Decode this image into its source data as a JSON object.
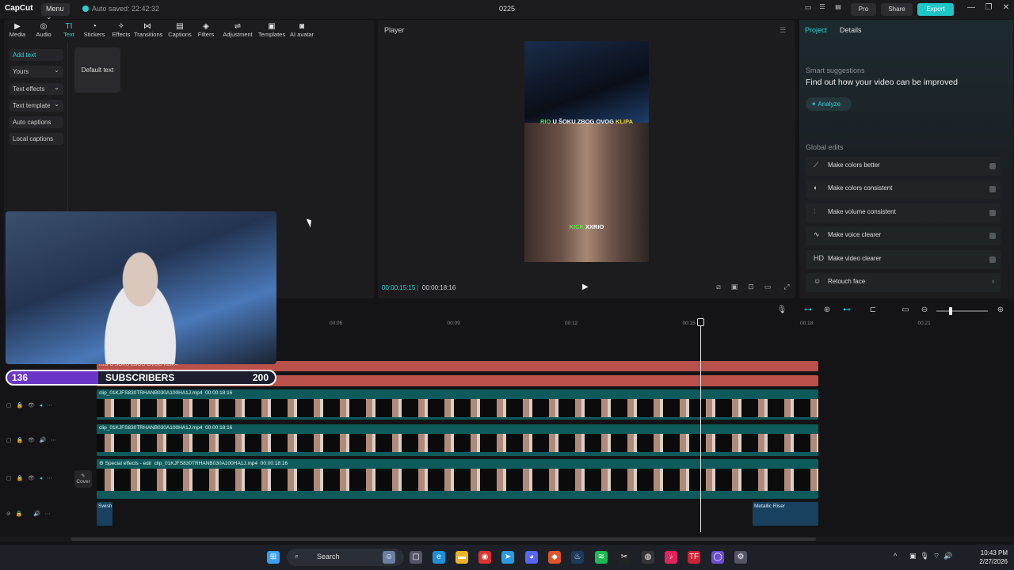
{
  "titlebar": {
    "app_name": "CapCut",
    "menu_label": "Menu",
    "autosave": "Auto saved: 22:42:32",
    "project_name": "0225",
    "pro_label": "Pro",
    "share_label": "Share",
    "export_label": "Export"
  },
  "toolbar": {
    "items": [
      {
        "label": "Media",
        "icon": "media-icon"
      },
      {
        "label": "Audio",
        "icon": "audio-icon"
      },
      {
        "label": "Text",
        "icon": "text-icon"
      },
      {
        "label": "Stickers",
        "icon": "stickers-icon"
      },
      {
        "label": "Effects",
        "icon": "effects-icon"
      },
      {
        "label": "Transitions",
        "icon": "transitions-icon"
      },
      {
        "label": "Captions",
        "icon": "captions-icon"
      },
      {
        "label": "Filters",
        "icon": "filters-icon"
      },
      {
        "label": "Adjustment",
        "icon": "adjustment-icon"
      },
      {
        "label": "Templates",
        "icon": "templates-icon"
      },
      {
        "label": "AI avatar",
        "icon": "ai-avatar-icon"
      }
    ],
    "active": "Text"
  },
  "text_sidebar": {
    "items": [
      "Add text",
      "Yours",
      "Text effects",
      "Text template",
      "Auto captions",
      "Local captions"
    ],
    "default_card": "Default text"
  },
  "player": {
    "title": "Player",
    "caption_top": {
      "a": "RIO",
      "b": "U ŠOKU ZBOG OVOG",
      "c": "KLIPA"
    },
    "caption_bottom": {
      "a": "KICK",
      "b": "XXRIO"
    },
    "time_current": "00:00:15:15",
    "time_total": "00:00:18:16"
  },
  "right_panel": {
    "tab_project": "Project",
    "tab_details": "Details",
    "smart_label": "Smart suggestions",
    "smart_title": "Find out how your video can be improved",
    "analyze_label": "Analyze",
    "global_label": "Global edits",
    "global_edits": [
      {
        "label": "Make colors better",
        "icon": "magic-wand-icon"
      },
      {
        "label": "Make colors consistent",
        "icon": "palette-icon"
      },
      {
        "label": "Make volume consistent",
        "icon": "sliders-icon"
      },
      {
        "label": "Make voice clearer",
        "icon": "waveform-icon"
      },
      {
        "label": "Make video clearer",
        "icon": "hd-icon"
      },
      {
        "label": "Retouch face",
        "icon": "face-icon"
      }
    ],
    "accent": "#2cd1d4"
  },
  "timeline": {
    "ticks": [
      "00:06",
      "00:09",
      "00:12",
      "00:15",
      "00:18",
      "00:21"
    ],
    "text_clip": "RIO U ŠOKU ZBOG OVOG KLIPA",
    "video_clip1": "clip_01KJFS830TRHANB030A100HA1J.mp4",
    "video_clip1_dur": "00:00:18:16",
    "video_clip2": "clip_01KJFS830TRHANB030A100HA1J.mp4",
    "video_clip2_dur": "00:00:18:16",
    "main_clip": "Special effects - edit",
    "main_clip_file": "clip_01KJFS830TRHANB030A100HA1J.mp4",
    "main_clip_dur": "00:00:18:16",
    "audio1": "Swish",
    "audio2": "Metallic Riser",
    "cover_label": "Cover"
  },
  "overlay": {
    "sub_current": "136",
    "sub_label": "SUBSCRIBERS",
    "sub_goal": "200",
    "goal_progress": 0.68
  },
  "taskbar": {
    "search": "Search",
    "time": "10:43 PM",
    "date": "2/27/2026"
  }
}
